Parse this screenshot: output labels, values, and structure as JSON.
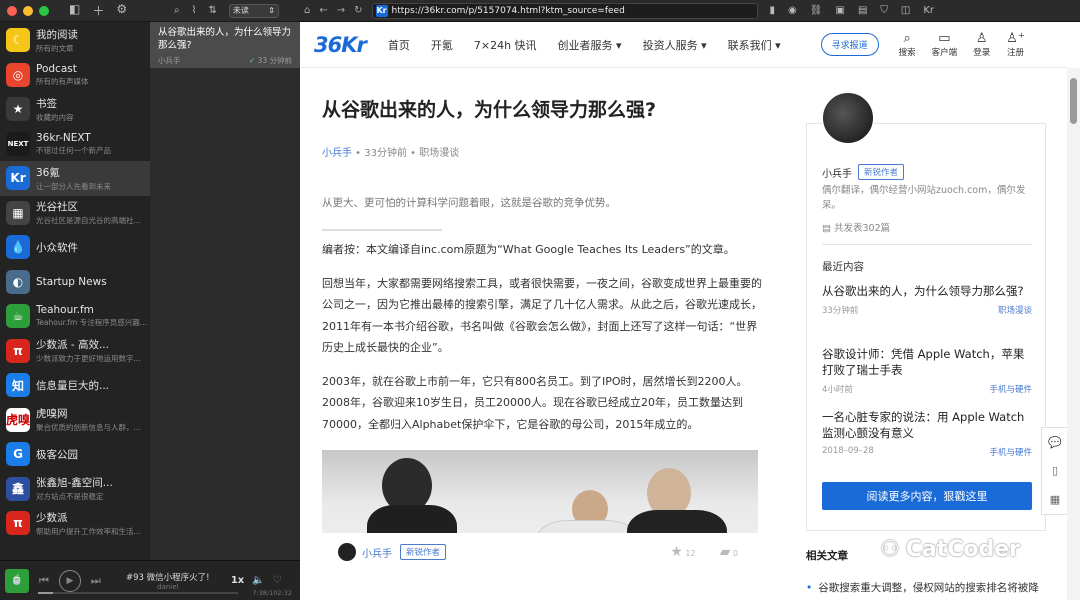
{
  "sidebar": {
    "feeds": [
      {
        "title": "我的阅读",
        "subtitle": "所有的文章",
        "icon": "moon-icon",
        "color": "#f5c518",
        "glyph": "☾"
      },
      {
        "title": "Podcast",
        "subtitle": "所有的有声媒体",
        "icon": "podcast-icon",
        "color": "#e8452c",
        "glyph": "◎"
      },
      {
        "title": "书签",
        "subtitle": "收藏的内容",
        "icon": "star-icon",
        "color": "#3a3a3a",
        "glyph": "★"
      },
      {
        "title": "36kr-NEXT",
        "subtitle": "不错过任何一个新产品",
        "icon": "next-icon",
        "color": "#1b1b1b",
        "glyph": "NEXT"
      },
      {
        "title": "36氪",
        "subtitle": "让一部分人先看到未来",
        "icon": "36kr-icon",
        "color": "#1a6bd8",
        "glyph": "Kr"
      },
      {
        "title": "光谷社区",
        "subtitle": "光谷社区是源自光谷的高端社...",
        "icon": "guanggu-icon",
        "color": "#444444",
        "glyph": "▦"
      },
      {
        "title": "小众软件",
        "subtitle": "",
        "icon": "drop-icon",
        "color": "#1a6bd8",
        "glyph": "💧"
      },
      {
        "title": "Startup News",
        "subtitle": "",
        "icon": "startup-icon",
        "color": "#4a6c8c",
        "glyph": "◐"
      },
      {
        "title": "Teahour.fm",
        "subtitle": "Teahour.fm 专注程序员感兴趣...",
        "icon": "teahour-icon",
        "color": "#2c9f3a",
        "glyph": "☕"
      },
      {
        "title": "少数派 - 高效...",
        "subtitle": "少数派致力于更好地运用数字...",
        "icon": "sspai-icon",
        "color": "#d9261c",
        "glyph": "π"
      },
      {
        "title": "信息量巨大的...",
        "subtitle": "",
        "icon": "zhihu-icon",
        "color": "#1a7de8",
        "glyph": "知"
      },
      {
        "title": "虎嗅网",
        "subtitle": "聚合优质的创新信息与人群，...",
        "icon": "huxiu-icon",
        "color": "#ffffff",
        "glyph": "虎嗅"
      },
      {
        "title": "极客公园",
        "subtitle": "",
        "icon": "geekpark-icon",
        "color": "#1a7de8",
        "glyph": "G"
      },
      {
        "title": "张鑫旭-鑫空间...",
        "subtitle": "对方站点不是很稳定",
        "icon": "zxx-icon",
        "color": "#2d4fa0",
        "glyph": "鑫"
      },
      {
        "title": "少数派",
        "subtitle": "帮助用户提升工作效率和生活...",
        "icon": "sspai2-icon",
        "color": "#d9261c",
        "glyph": "π"
      }
    ]
  },
  "list": {
    "filter": "未读",
    "item": {
      "title": "从谷歌出来的人，为什么领导力那么强?",
      "author": "小兵手",
      "time": "33 分钟前"
    }
  },
  "player": {
    "art": "🍵",
    "title": "#93 微信小程序火了!",
    "artist": "daniel",
    "speed": "1x",
    "time": "7:38/102:32",
    "progress": 0.074
  },
  "browser": {
    "url": "https://36kr.com/p/5157074.html?ktm_source=feed",
    "favicon": "Kr"
  },
  "site": {
    "logo": "36Kr",
    "nav": [
      "首页",
      "开氪",
      "7×24h 快讯",
      "创业者服务 ▾",
      "投资人服务 ▾",
      "联系我们 ▾"
    ],
    "report_btn": "寻求报道",
    "icons": [
      {
        "label": "搜索",
        "glyph": "⌕",
        "name": "search-icon"
      },
      {
        "label": "客户端",
        "glyph": "▭",
        "name": "desktop-icon"
      },
      {
        "label": "登录",
        "glyph": "♙",
        "name": "user-icon"
      },
      {
        "label": "注册",
        "glyph": "♙⁺",
        "name": "register-icon"
      }
    ]
  },
  "article": {
    "title": "从谷歌出来的人，为什么领导力那么强?",
    "author": "小兵手",
    "time": "33分钟前",
    "category": "职场漫谈",
    "summary": "从更大、更可怕的计算科学问题着眼，这就是谷歌的竞争优势。",
    "p1": "编者按：本文编译自inc.com原题为“What Google Teaches Its Leaders”的文章。",
    "p2": "回想当年，大家都需要网络搜索工具，或者很快需要，一夜之间，谷歌变成世界上最重要的公司之一，因为它推出最棒的搜索引擎，满足了几十亿人需求。从此之后，谷歌光速成长，2011年有一本书介绍谷歌，书名叫做《谷歌会怎么做》，封面上还写了这样一句话：“世界历史上成长最快的企业”。",
    "p3": "2003年，就在谷歌上市前一年，它只有800名员工。到了IPO时，居然增长到2200人。2008年，谷歌迎来10岁生日，员工20000人。现在谷歌已经成立20年，员工数量达到70000，全都归入Alphabet保护伞下，它是谷歌的母公司，2015年成立的。",
    "author_bar": {
      "name": "小兵手",
      "badge": "新锐作者",
      "likes": "12",
      "comments": "0"
    }
  },
  "card": {
    "name": "小兵手",
    "badge": "新锐作者",
    "bio": "偶尔翻译，偶尔经营小网站zuoch.com，偶尔发呆。",
    "count": "共发表302篇",
    "section": "最近内容",
    "recent": [
      {
        "title": "从谷歌出来的人，为什么领导力那么强?",
        "time": "33分钟前",
        "category": "职场漫谈"
      },
      {
        "title": "谷歌设计师：凭借 Apple Watch，苹果打败了瑞士手表",
        "time": "4小时前",
        "category": "手机与硬件"
      },
      {
        "title": "一名心脏专家的说法：用 Apple Watch 监测心颤没有意义",
        "time": "2018–09–28",
        "category": "手机与硬件"
      }
    ],
    "more_btn": "阅读更多内容，狠戳这里"
  },
  "related": {
    "heading": "相关文章",
    "item": "谷歌搜索重大调整，侵权网站的搜索排名将被降"
  },
  "watermark": "CatCoder"
}
